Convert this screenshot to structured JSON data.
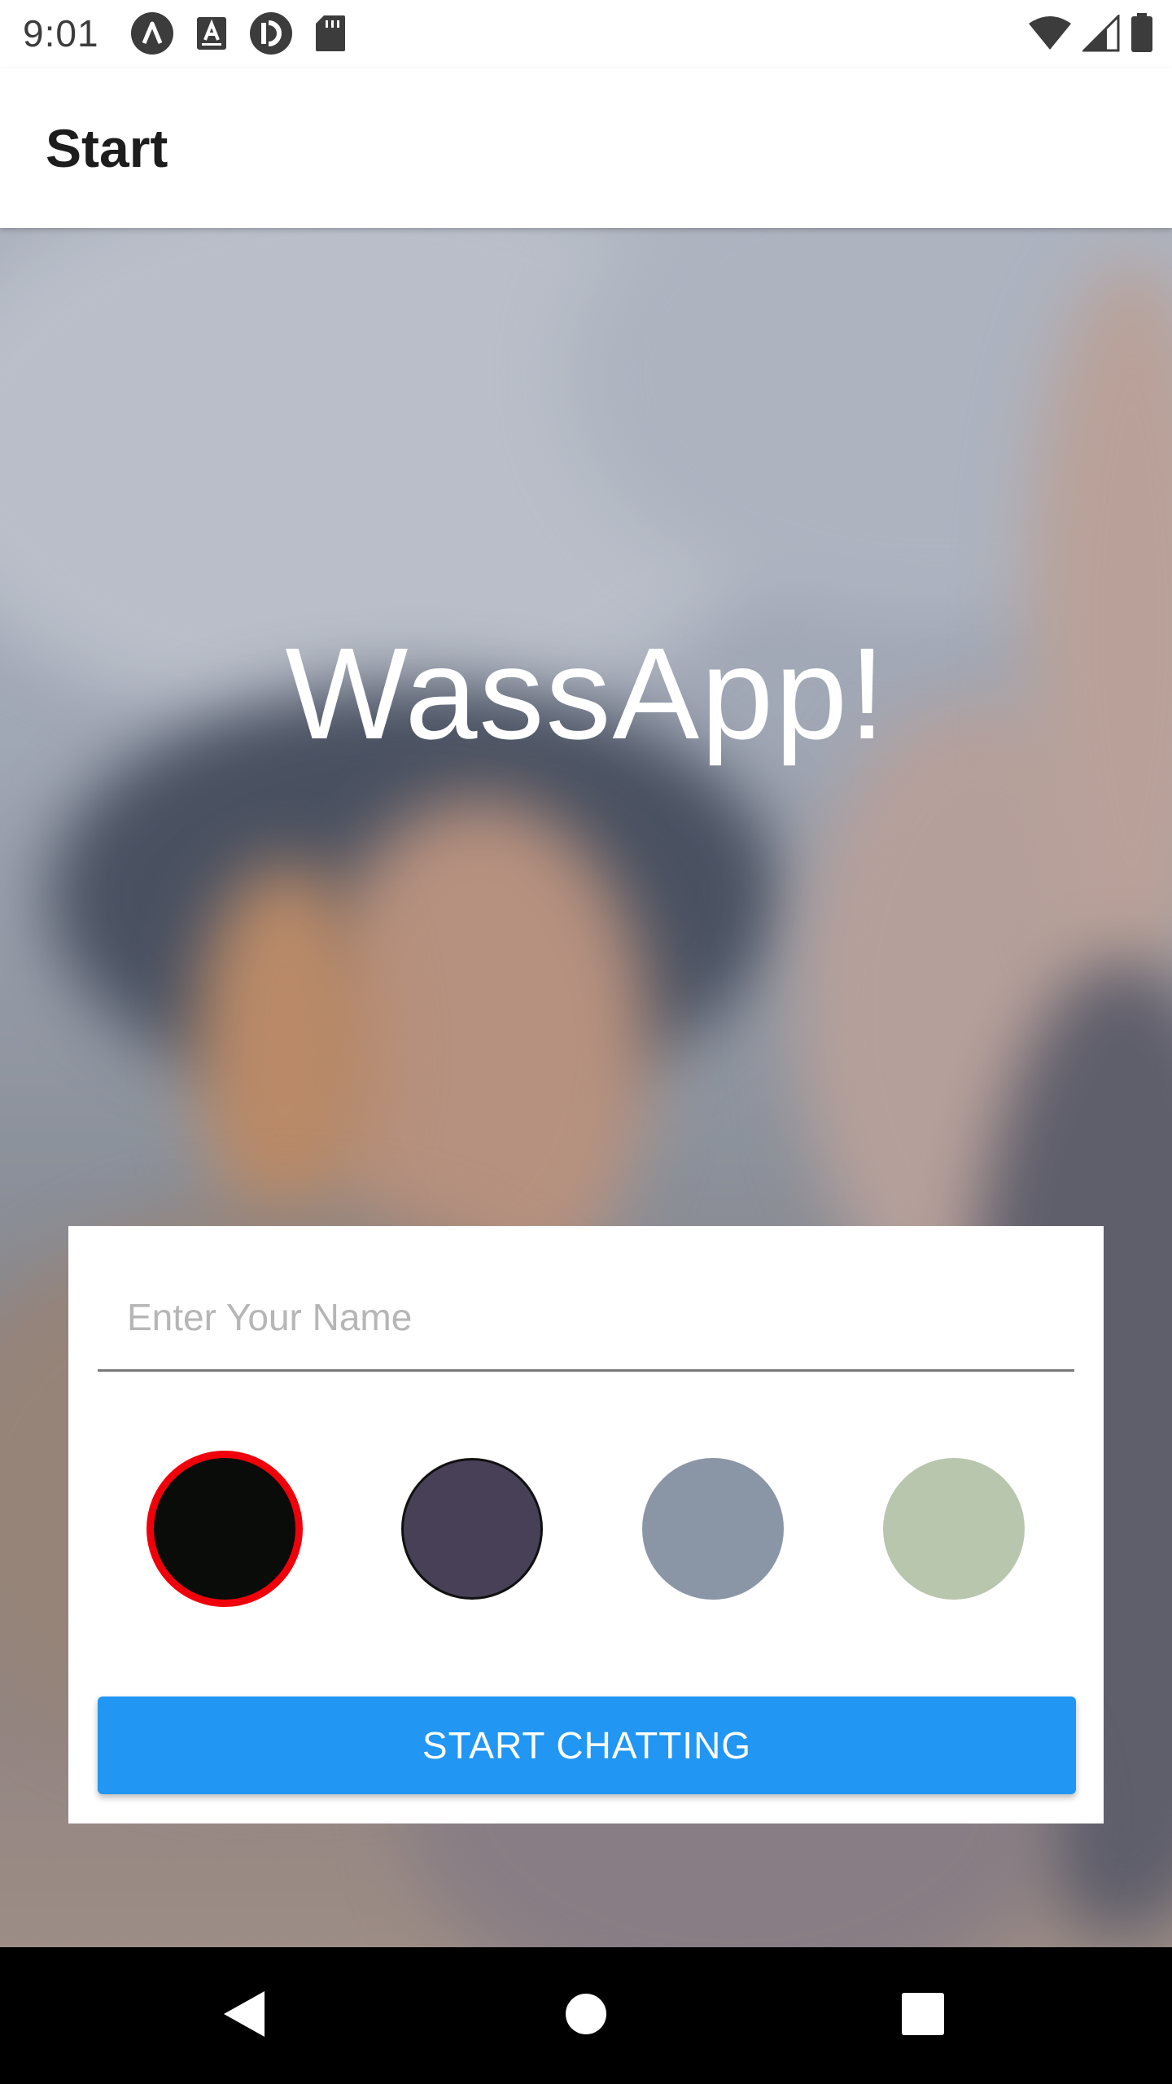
{
  "status_bar": {
    "time": "9:01",
    "left_icons": [
      "app-a-icon",
      "keyboard-a-icon",
      "pocket-casts-icon",
      "sd-card-icon"
    ],
    "right_icons": [
      "wifi-icon",
      "cellular-signal-icon",
      "battery-icon"
    ]
  },
  "app_bar": {
    "title": "Start"
  },
  "hero": {
    "title": "WassApp!"
  },
  "form": {
    "name_placeholder": "Enter Your Name",
    "name_value": "",
    "colors": [
      {
        "hex": "#090C08",
        "selected": true
      },
      {
        "hex": "#474056",
        "selected": false
      },
      {
        "hex": "#8A95A5",
        "selected": false
      },
      {
        "hex": "#B9C6AE",
        "selected": false
      }
    ],
    "selected_border_color": "#F0000A",
    "start_button_label": "START CHATTING",
    "accent_color": "#2196F3"
  },
  "nav_bar": {
    "buttons": [
      "back-icon",
      "home-icon",
      "recents-icon"
    ]
  }
}
